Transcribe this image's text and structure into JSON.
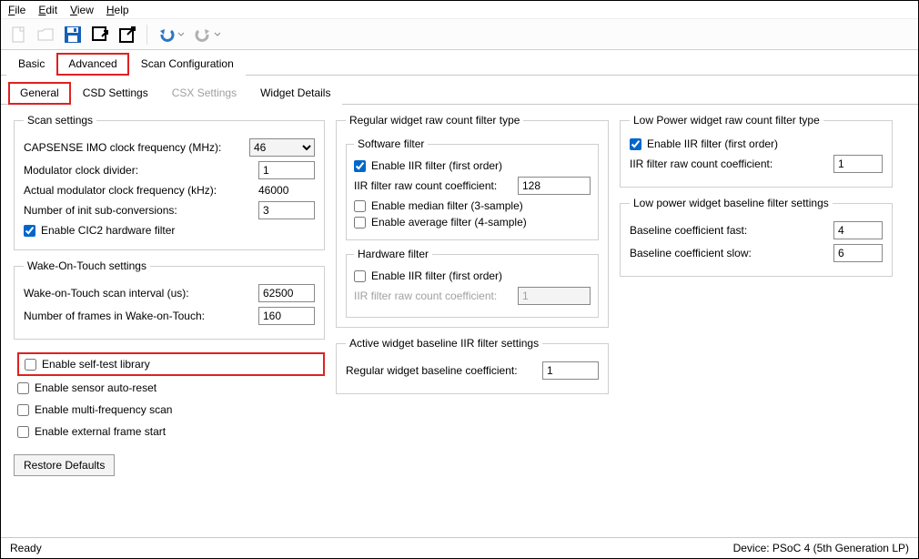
{
  "menu": {
    "file": "File",
    "edit": "Edit",
    "view": "View",
    "help": "Help"
  },
  "tabs1": {
    "basic": "Basic",
    "advanced": "Advanced",
    "scanconfig": "Scan Configuration"
  },
  "tabs2": {
    "general": "General",
    "csd": "CSD Settings",
    "csx": "CSX Settings",
    "widget": "Widget Details"
  },
  "scan": {
    "legend": "Scan settings",
    "imo_label": "CAPSENSE IMO clock frequency (MHz):",
    "imo_value": "46",
    "mod_label": "Modulator clock divider:",
    "mod_value": "1",
    "actual_label": "Actual modulator clock frequency (kHz):",
    "actual_value": "46000",
    "init_label": "Number of init sub-conversions:",
    "init_value": "3",
    "cic2_label": "Enable CIC2 hardware filter"
  },
  "wot": {
    "legend": "Wake-On-Touch settings",
    "interval_label": "Wake-on-Touch scan interval (us):",
    "interval_value": "62500",
    "frames_label": "Number of frames in Wake-on-Touch:",
    "frames_value": "160"
  },
  "misc": {
    "selftest": "Enable self-test library",
    "autoreset": "Enable sensor auto-reset",
    "multifreq": "Enable multi-frequency scan",
    "extframe": "Enable external frame start"
  },
  "restore": "Restore Defaults",
  "regfilter": {
    "legend": "Regular widget raw count filter type",
    "sw_legend": "Software filter",
    "iir1": "Enable IIR filter (first order)",
    "iir_coef_label": "IIR filter raw count coefficient:",
    "iir_coef_value": "128",
    "median": "Enable median filter (3-sample)",
    "average": "Enable average filter (4-sample)",
    "hw_legend": "Hardware filter",
    "hw_iir": "Enable IIR filter (first order)",
    "hw_coef_label": "IIR filter raw count coefficient:",
    "hw_coef_value": "1"
  },
  "activebase": {
    "legend": "Active widget baseline IIR filter settings",
    "reg_label": "Regular widget baseline coefficient:",
    "reg_value": "1"
  },
  "lpfilter": {
    "legend": "Low Power widget raw count filter type",
    "iir": "Enable IIR filter (first order)",
    "coef_label": "IIR filter raw count coefficient:",
    "coef_value": "1"
  },
  "lpbase": {
    "legend": "Low power widget baseline filter settings",
    "fast_label": "Baseline coefficient fast:",
    "fast_value": "4",
    "slow_label": "Baseline coefficient slow:",
    "slow_value": "6"
  },
  "status": {
    "left": "Ready",
    "right": "Device: PSoC 4 (5th Generation LP)"
  }
}
